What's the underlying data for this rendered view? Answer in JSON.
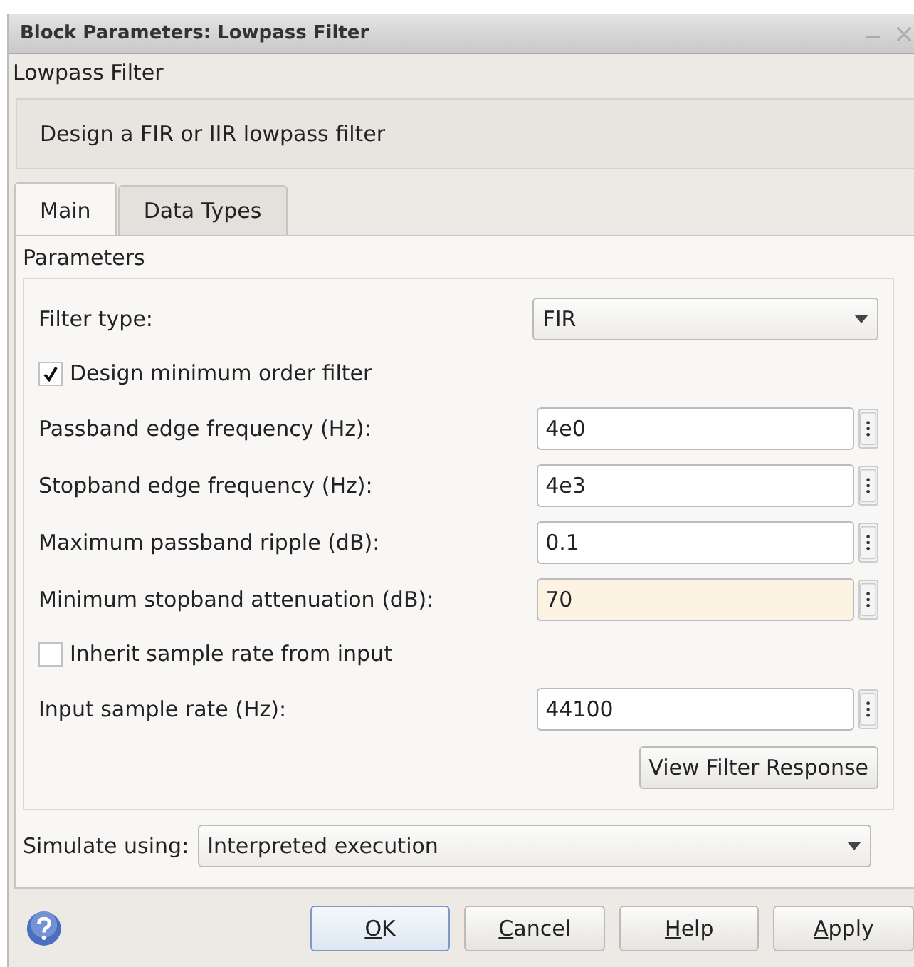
{
  "window": {
    "title": "Block Parameters: Lowpass Filter"
  },
  "block_name": "Lowpass Filter",
  "description": "Design a FIR or IIR lowpass filter",
  "tabs": [
    {
      "label": "Main",
      "selected": true
    },
    {
      "label": "Data Types",
      "selected": false
    }
  ],
  "section_title": "Parameters",
  "parameters": [
    {
      "kind": "dropdown",
      "label": "Filter type:",
      "value": "FIR"
    },
    {
      "kind": "checkbox",
      "label": "Design minimum order filter",
      "checked": true
    },
    {
      "kind": "field",
      "label": "Passband edge frequency (Hz):",
      "value": "4e0",
      "highlighted": false
    },
    {
      "kind": "field",
      "label": "Stopband edge frequency (Hz):",
      "value": "4e3",
      "highlighted": false
    },
    {
      "kind": "field",
      "label": "Maximum passband ripple (dB):",
      "value": "0.1",
      "highlighted": false
    },
    {
      "kind": "field",
      "label": "Minimum stopband attenuation (dB):",
      "value": "70",
      "highlighted": true
    },
    {
      "kind": "checkbox",
      "label": "Inherit sample rate from input",
      "checked": false
    },
    {
      "kind": "field",
      "label": "Input sample rate (Hz):",
      "value": "44100",
      "highlighted": false
    },
    {
      "kind": "button",
      "label": "View Filter Response"
    }
  ],
  "simulate": {
    "label": "Simulate using:",
    "value": "Interpreted execution"
  },
  "buttons": [
    {
      "label": "OK",
      "underline_first": true,
      "default": true
    },
    {
      "label": "Cancel",
      "underline_first": true,
      "default": false
    },
    {
      "label": "Help",
      "underline_first": true,
      "default": false
    },
    {
      "label": "Apply",
      "underline_first": true,
      "default": false
    }
  ]
}
